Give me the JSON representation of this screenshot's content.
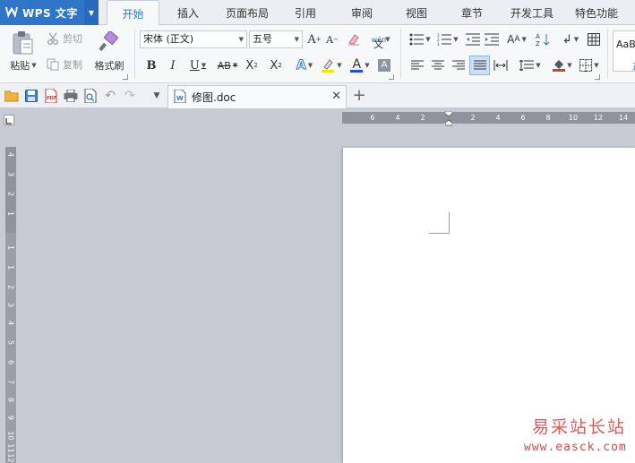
{
  "app": {
    "title": "WPS 文字"
  },
  "menu": {
    "tabs": [
      {
        "label": "开始"
      },
      {
        "label": "插入"
      },
      {
        "label": "页面布局"
      },
      {
        "label": "引用"
      },
      {
        "label": "审阅"
      },
      {
        "label": "视图"
      },
      {
        "label": "章节"
      },
      {
        "label": "开发工具"
      },
      {
        "label": "特色功能"
      }
    ],
    "active": "开始"
  },
  "ribbon": {
    "clipboard": {
      "paste": "粘贴",
      "cut": "剪切",
      "copy": "复制",
      "format_painter": "格式刷"
    },
    "font": {
      "name": "宋体 (正文)",
      "size": "五号"
    },
    "styles": {
      "preview": "AaB",
      "normal": "正"
    }
  },
  "document": {
    "tab_name": "修图.doc"
  },
  "ruler": {
    "horizontal": [
      "6",
      "4",
      "2",
      "2",
      "4",
      "6",
      "8",
      "10",
      "12",
      "14"
    ],
    "vertical": [
      "4",
      "3",
      "2",
      "1",
      "1",
      "1",
      "2",
      "3",
      "4",
      "5",
      "6",
      "7",
      "8",
      "9",
      "10",
      "11",
      "12"
    ]
  },
  "watermark": {
    "line1": "易采站长站",
    "line2": "www.easck.com"
  },
  "colors": {
    "accent": "#2f76c8",
    "font_color": "#1d4fd8",
    "highlight": "#f1e800",
    "paint": "#d83a2f"
  }
}
